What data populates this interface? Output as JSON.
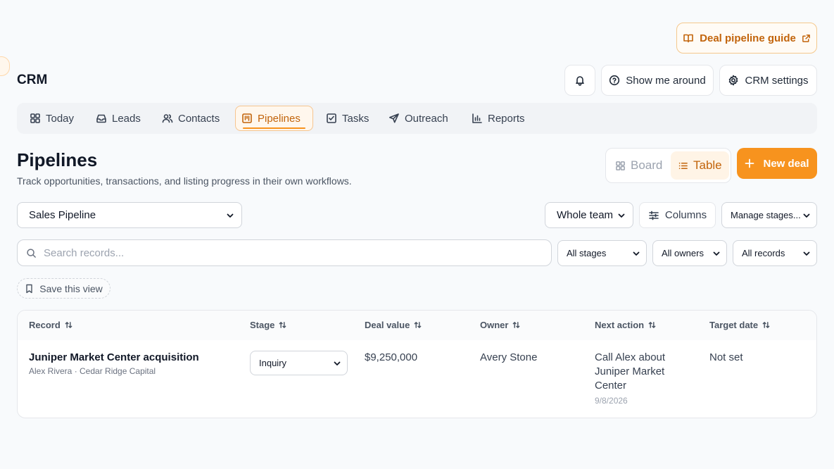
{
  "app": {
    "title": "CRM"
  },
  "header": {
    "guide_label": "Deal pipeline guide",
    "tour_label": "Show me around",
    "settings_label": "CRM settings"
  },
  "tabs": [
    {
      "label": "Today",
      "icon": "grid-icon"
    },
    {
      "label": "Leads",
      "icon": "inbox-icon"
    },
    {
      "label": "Contacts",
      "icon": "users-icon"
    },
    {
      "label": "Pipelines",
      "icon": "kanban-icon",
      "active": true
    },
    {
      "label": "Tasks",
      "icon": "checkbox-icon"
    },
    {
      "label": "Outreach",
      "icon": "send-icon"
    },
    {
      "label": "Reports",
      "icon": "bar-chart-icon"
    }
  ],
  "page": {
    "title": "Pipelines",
    "subtitle": "Track opportunities, transactions, and listing progress in their own workflows."
  },
  "view_toggle": {
    "board_label": "Board",
    "table_label": "Table",
    "selected": "Table"
  },
  "new_deal_label": "New deal",
  "filters": {
    "pipeline": "Sales Pipeline",
    "team": "Whole team",
    "columns_label": "Columns",
    "manage_stages": "Manage stages...",
    "search_placeholder": "Search records...",
    "stages": "All stages",
    "owners": "All owners",
    "records": "All records",
    "save_view_label": "Save this view"
  },
  "table": {
    "columns": [
      "Record",
      "Stage",
      "Deal value",
      "Owner",
      "Next action",
      "Target date"
    ],
    "rows": [
      {
        "record_title": "Juniper Market Center acquisition",
        "record_subtitle": "Alex Rivera · Cedar Ridge Capital",
        "stage": "Inquiry",
        "deal_value": "$9,250,000",
        "owner": "Avery Stone",
        "next_action": "Call Alex about Juniper Market Center",
        "next_action_date": "9/8/2026",
        "target_date": "Not set"
      }
    ]
  },
  "colors": {
    "accent": "#f7931e",
    "accent_text": "#c2640b",
    "background": "#f8fafc"
  }
}
